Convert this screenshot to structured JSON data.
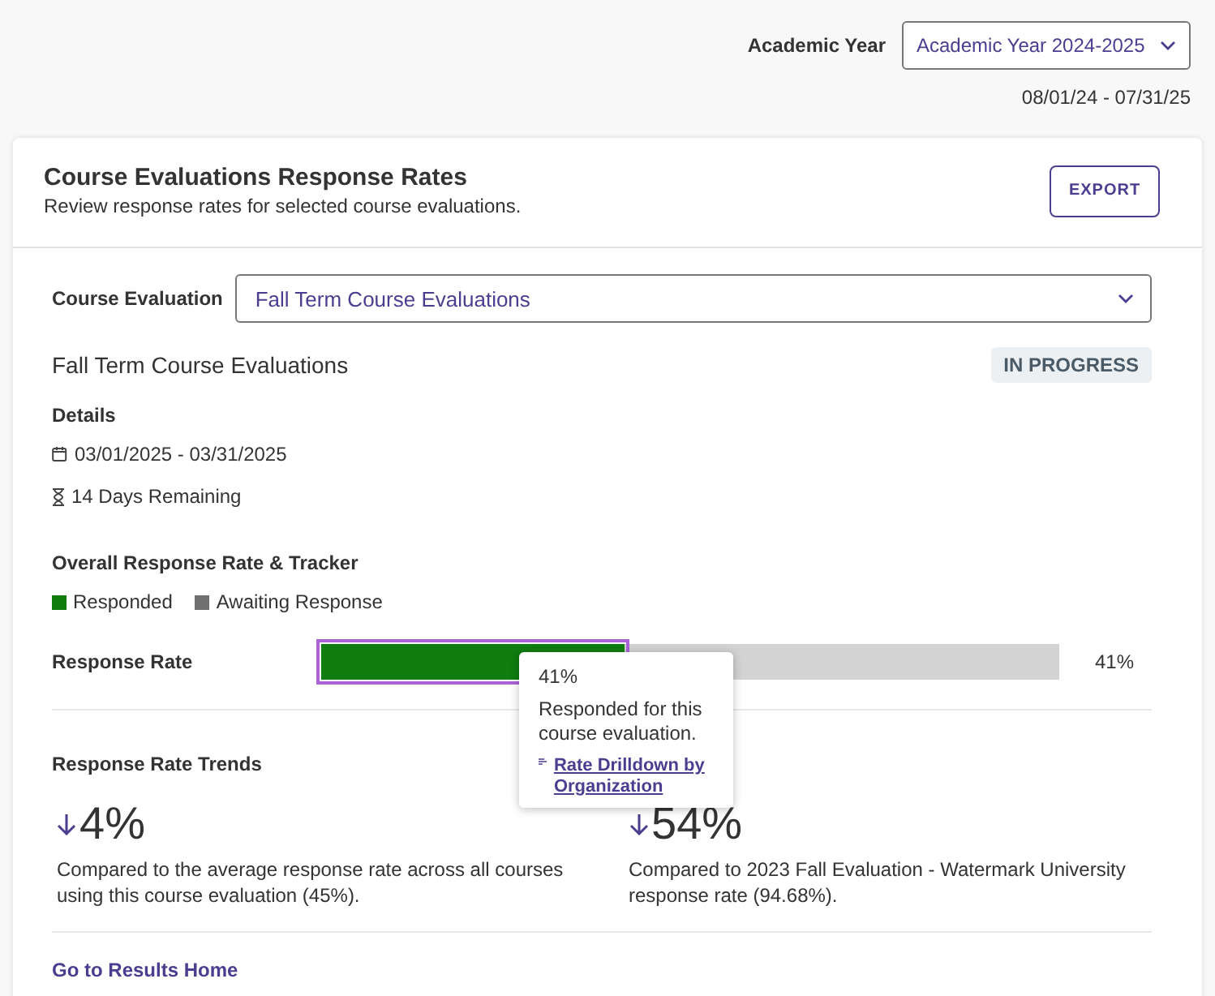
{
  "filter": {
    "label": "Academic Year",
    "value": "Academic Year 2024-2025",
    "date_range": "08/01/24 - 07/31/25"
  },
  "card": {
    "title": "Course Evaluations Response Rates",
    "subtitle": "Review response rates for selected course evaluations.",
    "export_button": "EXPORT"
  },
  "course_evaluation": {
    "label": "Course Evaluation",
    "value": "Fall Term Course Evaluations"
  },
  "evaluation": {
    "title": "Fall Term Course Evaluations",
    "status": "IN PROGRESS",
    "details_heading": "Details",
    "date_range": "03/01/2025 - 03/31/2025",
    "remaining": "14 Days Remaining"
  },
  "tracker": {
    "heading": "Overall Response Rate & Tracker",
    "legend": [
      {
        "label": "Responded",
        "color": "#0f7d0f"
      },
      {
        "label": "Awaiting Response",
        "color": "#6f6f6f"
      }
    ],
    "label": "Response Rate",
    "level": 0.41,
    "reading": "41%"
  },
  "tooltip": {
    "value": "41%",
    "text": "Responded for this course evaluation.",
    "link": "Rate Drilldown by Organization"
  },
  "trends": {
    "heading": "Response Rate Trends",
    "items": [
      {
        "kind": "down",
        "value": "4%",
        "text": "Compared to the average response rate across all courses using this course evaluation (45%)."
      },
      {
        "kind": "down",
        "value": "54%",
        "text": "Compared to 2023 Fall Evaluation - Watermark University response rate (94.68%)."
      }
    ]
  },
  "footer_link": "Go to Results Home"
}
